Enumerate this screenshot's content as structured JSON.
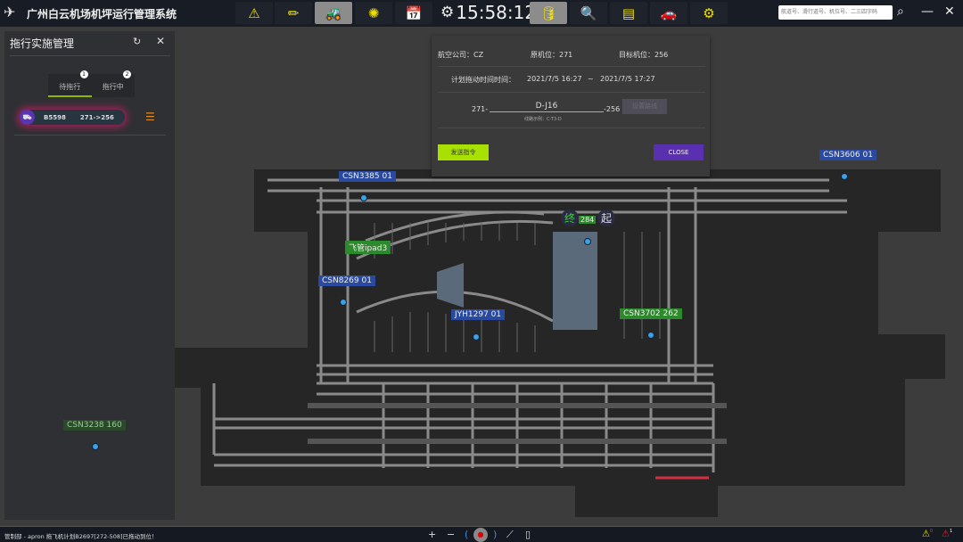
{
  "app": {
    "title": "广州白云机场机坪运行管理系统",
    "clock": "15:58:12",
    "search_placeholder": "航道号、滑行道号、机位号、二三四字码"
  },
  "toolbar": [
    {
      "icon": "warning-icon"
    },
    {
      "icon": "pencil-icon"
    },
    {
      "icon": "tow-vehicle-icon",
      "active": true
    },
    {
      "icon": "wheel-icon"
    },
    {
      "icon": "calendar-icon"
    },
    {
      "icon": "database-icon",
      "active": true
    },
    {
      "icon": "document-search-icon"
    },
    {
      "icon": "layers-icon"
    },
    {
      "icon": "car-icon"
    },
    {
      "icon": "gear-icon"
    }
  ],
  "panel": {
    "title": "拖行实施管理",
    "tabs": [
      {
        "label": "待拖行",
        "count": "1"
      },
      {
        "label": "拖行中",
        "count": "2"
      }
    ],
    "tasks": [
      {
        "reg": "B5598",
        "route": "271->256"
      }
    ]
  },
  "dialog": {
    "airline": "航空公司：CZ",
    "origin": "原机位：271",
    "target": "目标机位：256",
    "time_label": "计划拖动时间时间：",
    "start": "2021/7/5 16:27",
    "sep": "~",
    "end": "2021/7/5 17:27",
    "route_prefix": "271-",
    "route_value": "D-J16",
    "route_suffix": "-256",
    "route_hint": "线路示例：C-T3-D",
    "set_route": "设置路线",
    "send": "发送指令",
    "close": "CLOSE"
  },
  "map": {
    "tags": [
      {
        "label": "CSN3385   01",
        "color": "blue"
      },
      {
        "label": "CSN3606   01",
        "color": "blue"
      },
      {
        "label": "CSN8269   01",
        "color": "blue"
      },
      {
        "label": "JYH1297   01",
        "color": "blue"
      },
      {
        "label": "CSN3702   262",
        "color": "green"
      },
      {
        "label": "CSN3238   160",
        "color": "dgreen"
      },
      {
        "label": "飞管ipad3",
        "color": "green"
      }
    ],
    "end_marker": "终",
    "start_marker": "起",
    "stand": "284"
  },
  "status": {
    "message": "管制部 - apron   拖飞机计划B2697[272-508]已拖动到位！",
    "zoom_in": "+",
    "zoom_out": "−",
    "alerts_yellow": "0",
    "alerts_red": "1"
  }
}
